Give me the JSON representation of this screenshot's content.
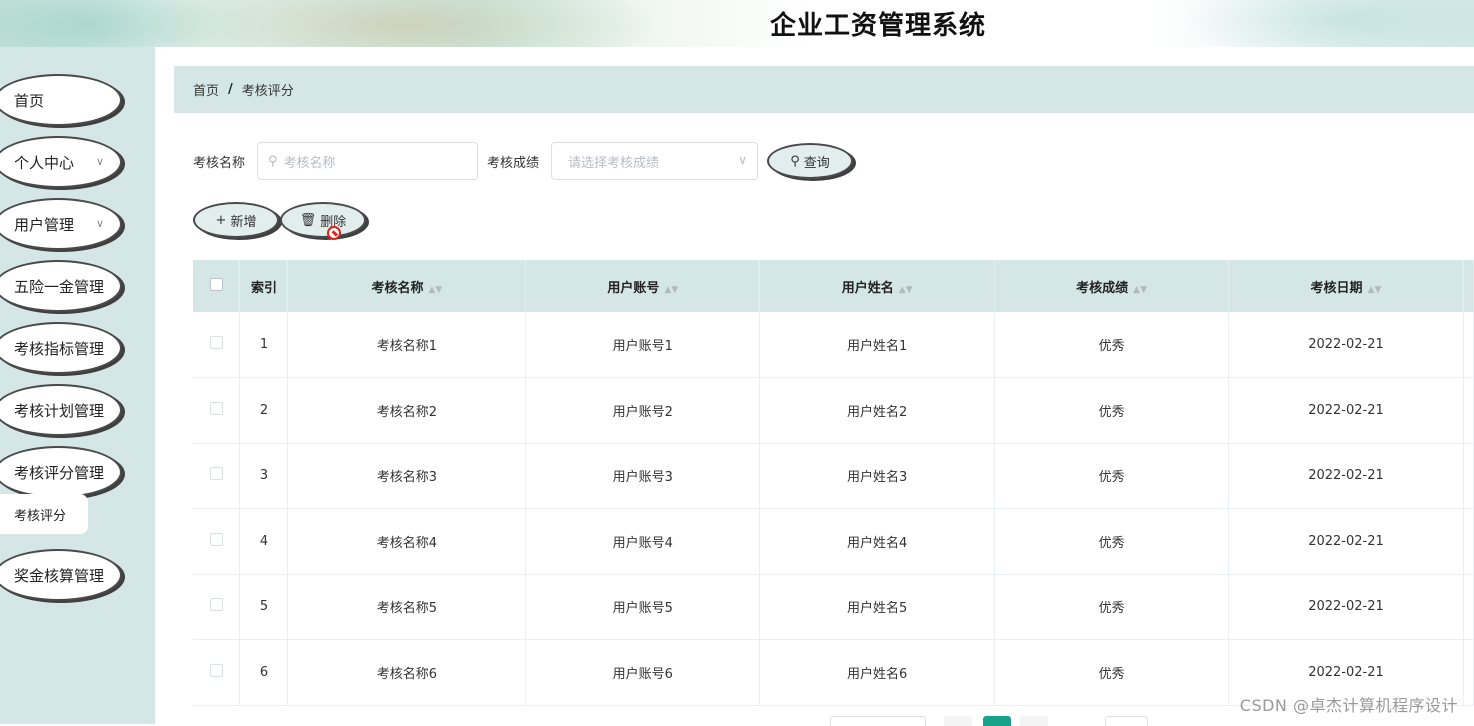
{
  "app": {
    "title": "企业工资管理系统"
  },
  "sidebar": {
    "items": [
      {
        "label": "首页",
        "has_children": false
      },
      {
        "label": "个人中心",
        "has_children": true
      },
      {
        "label": "用户管理",
        "has_children": true
      },
      {
        "label": "五险一金管理",
        "has_children": false
      },
      {
        "label": "考核指标管理",
        "has_children": false
      },
      {
        "label": "考核计划管理",
        "has_children": false
      },
      {
        "label": "考核评分管理",
        "has_children": false
      },
      {
        "label": "奖金核算管理",
        "has_children": false
      }
    ],
    "expanded_submenu": {
      "label": "考核评分"
    }
  },
  "breadcrumb": {
    "home": "首页",
    "separator": "/",
    "current": "考核评分"
  },
  "search": {
    "name_label": "考核名称",
    "name_placeholder": "考核名称",
    "grade_label": "考核成绩",
    "grade_placeholder": "请选择考核成绩",
    "query_button": "查询"
  },
  "actions": {
    "add_button": "新增",
    "delete_button": "删除"
  },
  "table": {
    "columns": [
      "索引",
      "考核名称",
      "用户账号",
      "用户姓名",
      "考核成绩",
      "考核日期"
    ],
    "rows": [
      {
        "index": "1",
        "name": "考核名称1",
        "account": "用户账号1",
        "username": "用户姓名1",
        "grade": "优秀",
        "date": "2022-02-21"
      },
      {
        "index": "2",
        "name": "考核名称2",
        "account": "用户账号2",
        "username": "用户姓名2",
        "grade": "优秀",
        "date": "2022-02-21"
      },
      {
        "index": "3",
        "name": "考核名称3",
        "account": "用户账号3",
        "username": "用户姓名3",
        "grade": "优秀",
        "date": "2022-02-21"
      },
      {
        "index": "4",
        "name": "考核名称4",
        "account": "用户账号4",
        "username": "用户姓名4",
        "grade": "优秀",
        "date": "2022-02-21"
      },
      {
        "index": "5",
        "name": "考核名称5",
        "account": "用户账号5",
        "username": "用户姓名5",
        "grade": "优秀",
        "date": "2022-02-21"
      },
      {
        "index": "6",
        "name": "考核名称6",
        "account": "用户账号6",
        "username": "用户姓名6",
        "grade": "优秀",
        "date": "2022-02-21"
      }
    ]
  },
  "watermark": "CSDN @卓杰计算机程序设计",
  "colors": {
    "accent": "#17a38a",
    "panel": "#d4e7e6"
  }
}
